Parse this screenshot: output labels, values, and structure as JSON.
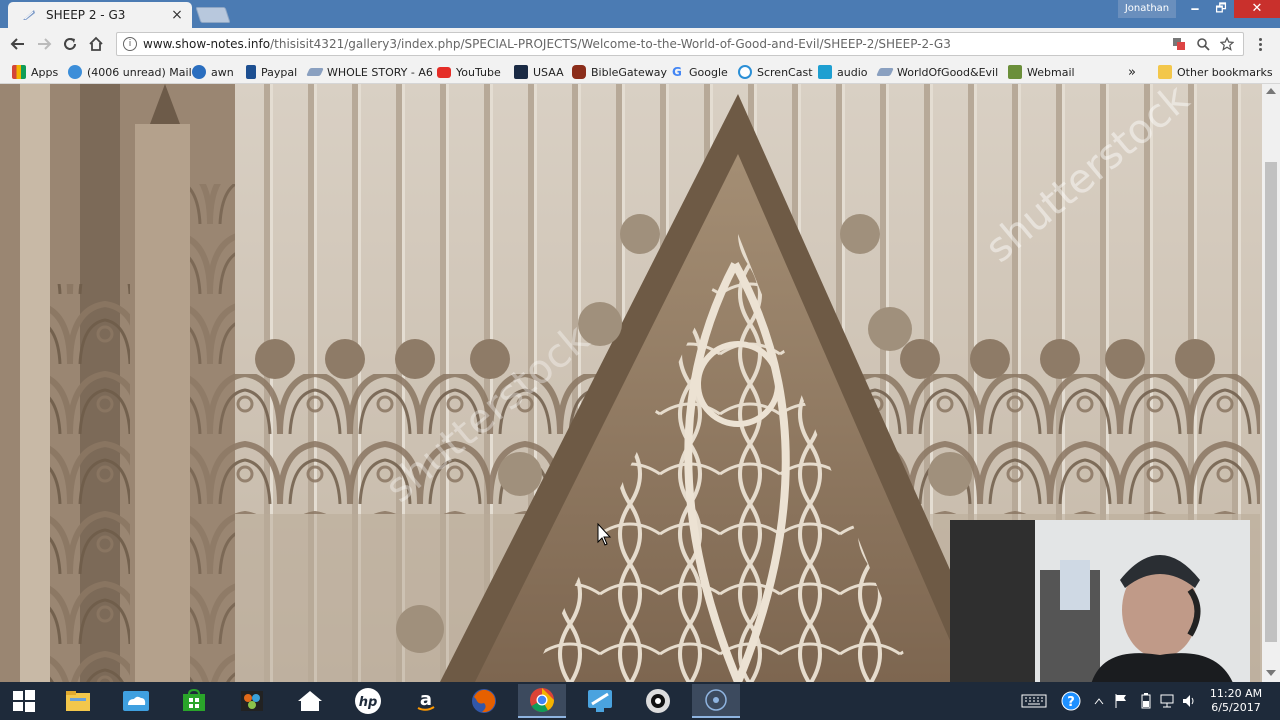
{
  "window": {
    "tab_title": "SHEEP 2 - G3",
    "user_name": "Jonathan",
    "minimize": "🗕",
    "maximize": "🗗",
    "close": "✕"
  },
  "address_bar": {
    "host": "www.show-notes.info",
    "path": "/thisisit4321/gallery3/index.php/SPECIAL-PROJECTS/Welcome-to-the-World-of-Good-and-Evil/SHEEP-2/SHEEP-2-G3"
  },
  "bookmarks": {
    "items": [
      {
        "label": "Apps",
        "icon": "apps-grid-icon",
        "color": "#d44638"
      },
      {
        "label": "(4006 unread) Mail",
        "icon": "mail-icon",
        "color": "#3c8ed9"
      },
      {
        "label": "awn",
        "icon": "awn-icon",
        "color": "#2a6ebf"
      },
      {
        "label": "Paypal",
        "icon": "paypal-icon",
        "color": "#1d4f91"
      },
      {
        "label": "WHOLE STORY - A6",
        "icon": "bookmark-feather-icon",
        "color": "#8aa0c0"
      },
      {
        "label": "YouTube",
        "icon": "youtube-icon",
        "color": "#e52d27"
      },
      {
        "label": "USAA",
        "icon": "usaa-icon",
        "color": "#1a2a44"
      },
      {
        "label": "BibleGateway",
        "icon": "biblegateway-icon",
        "color": "#8b2d1a"
      },
      {
        "label": "Google",
        "icon": "google-icon",
        "color": "#4285f4"
      },
      {
        "label": "ScrenCast",
        "icon": "screencast-icon",
        "color": "#2b8fd6"
      },
      {
        "label": "audio",
        "icon": "audio-icon",
        "color": "#1e9fd1"
      },
      {
        "label": "WorldOfGood&Evil",
        "icon": "bookmark-feather-icon",
        "color": "#8aa0c0"
      },
      {
        "label": "Webmail",
        "icon": "webmail-icon",
        "color": "#6b8f3a"
      }
    ],
    "overflow": "»",
    "other_label": "Other bookmarks"
  },
  "watermark": "shutterstock",
  "taskbar": {
    "apps": [
      {
        "name": "file-explorer-icon",
        "color": "#f3c74b"
      },
      {
        "name": "onedrive-icon",
        "color": "#3fa0e0"
      },
      {
        "name": "store-icon",
        "color": "#2aa52a"
      },
      {
        "name": "paint-app-icon",
        "color": "#e26a1a"
      },
      {
        "name": "home-icon",
        "color": "#ffffff"
      },
      {
        "name": "hp-icon",
        "color": "#ffffff"
      },
      {
        "name": "amazon-icon",
        "color": "#ffffff"
      },
      {
        "name": "firefox-icon",
        "color": "#e66000"
      },
      {
        "name": "chrome-icon",
        "color": "#4caf50"
      },
      {
        "name": "remote-app-icon",
        "color": "#4aa3df"
      },
      {
        "name": "webcam-app-icon",
        "color": "#dddddd"
      },
      {
        "name": "recording-icon",
        "color": "#8fb4e0"
      }
    ],
    "time": "11:20 AM",
    "date": "6/5/2017"
  }
}
